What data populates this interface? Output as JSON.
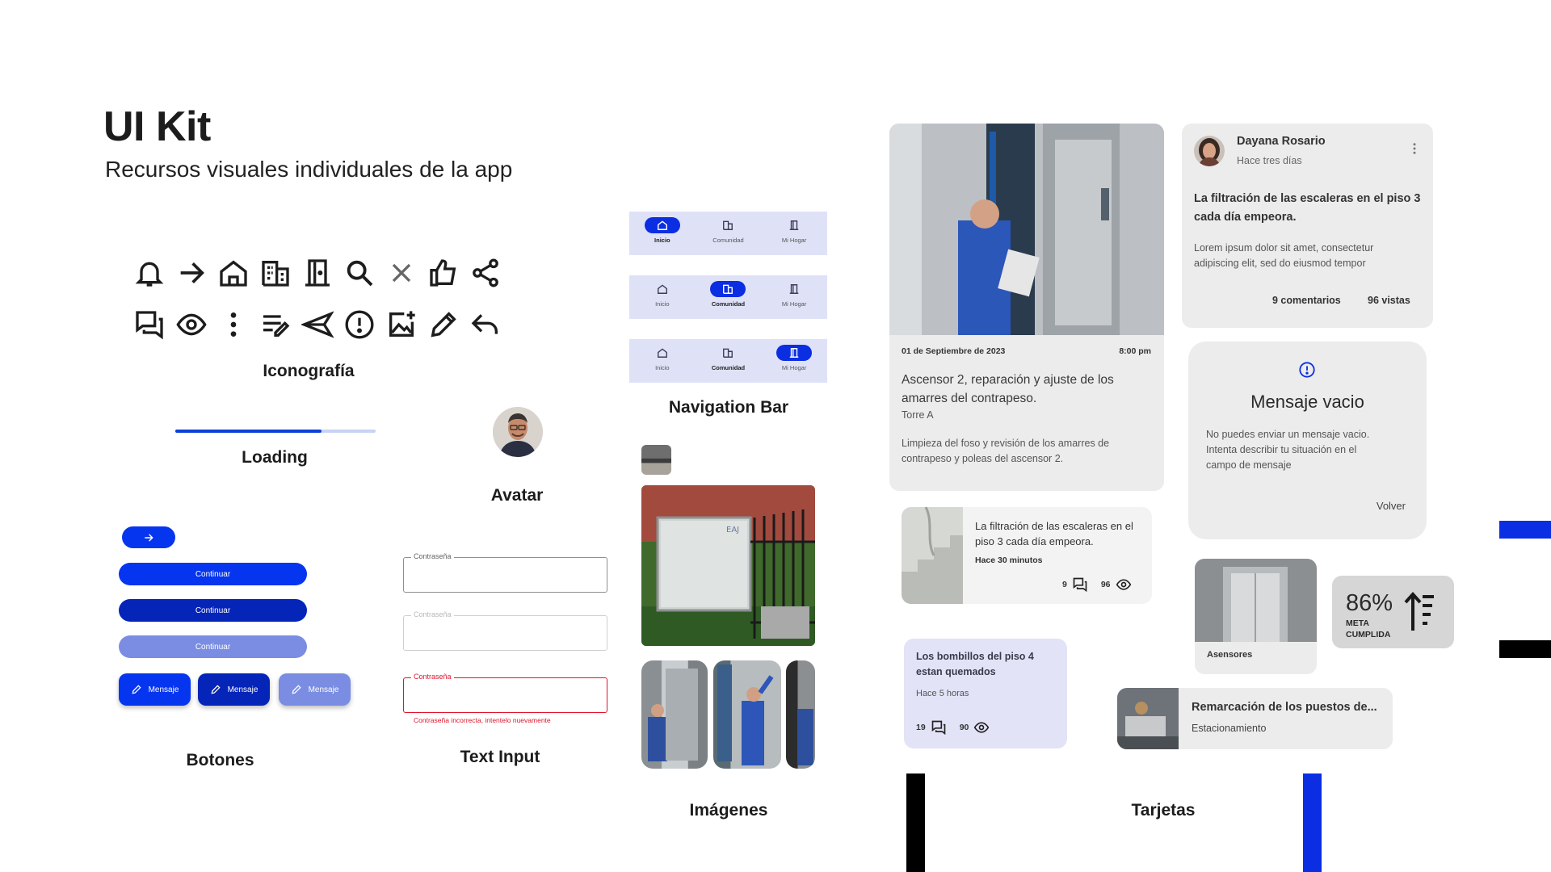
{
  "header": {
    "title": "UI Kit",
    "subtitle": "Recursos visuales individuales de la app"
  },
  "sections": {
    "iconography": "Iconografía",
    "loading": "Loading",
    "avatar": "Avatar",
    "buttons": "Botones",
    "text_input": "Text Input",
    "navigation_bar": "Navigation Bar",
    "images": "Imágenes",
    "cards": "Tarjetas"
  },
  "icons": {
    "row1": [
      "bell-icon",
      "arrow-right-icon",
      "home-icon",
      "apartment-icon",
      "door-icon",
      "search-icon",
      "close-icon",
      "thumb-up-icon",
      "share-icon"
    ],
    "row2": [
      "forum-icon",
      "eye-icon",
      "more-vertical-icon",
      "edit-note-icon",
      "send-icon",
      "alert-circle-icon",
      "add-photo-icon",
      "pencil-icon",
      "reply-icon"
    ]
  },
  "loading": {
    "progress": 0.73,
    "color": "#0b3fd8",
    "track": "#c9d3f3"
  },
  "navbar": {
    "items": [
      "Inicio",
      "Comunidad",
      "Mi Hogar"
    ],
    "active_indices": [
      0,
      1,
      2
    ]
  },
  "buttons": {
    "continue_label": "Continuar",
    "message_label": "Mensaje",
    "colors": {
      "primary": "#0635f0",
      "dark": "#0524b8",
      "disabled": "#7a8de2"
    }
  },
  "inputs": {
    "label": "Contraseña",
    "error_message": "Contraseña incorrecta, intentelo nuevamente",
    "error_color": "#e0142b"
  },
  "cards": {
    "feature": {
      "date": "01 de Septiembre de 2023",
      "time": "8:00 pm",
      "title": "Ascensor 2, reparación y ajuste de los amarres del contrapeso.",
      "location": "Torre A",
      "description": "Limpieza del foso y revisión de los amarres de contrapeso y poleas del ascensor 2."
    },
    "post": {
      "author": "Dayana Rosario",
      "time": "Hace tres días",
      "title": "La filtración de las escaleras en el piso 3 cada día empeora.",
      "body": "Lorem ipsum dolor sit amet, consectetur adipiscing elit, sed do eiusmod tempor",
      "comments": "9 comentarios",
      "views": "96 vistas"
    },
    "dialog": {
      "title": "Mensaje vacio",
      "body": "No puedes enviar un mensaje vacio. Intenta describir tu situación en el campo de mensaje",
      "action": "Volver"
    },
    "compact": {
      "title": "La filtración de las escaleras en el piso 3 cada día empeora.",
      "time": "Hace 30 minutos",
      "comments": "9",
      "views": "96"
    },
    "bulbs": {
      "title": "Los bombillos del piso 4 estan quemados",
      "time": "Hace 5 horas",
      "comments": "19",
      "views": "90"
    },
    "elevators": {
      "label": "Asensores"
    },
    "goal": {
      "percent": "86%",
      "label_line1": "META",
      "label_line2": "CUMPLIDA"
    },
    "parking": {
      "title": "Remarcación de los puestos de...",
      "subtitle": "Estacionamiento"
    }
  },
  "colors": {
    "accent": "#0b2ee3",
    "card_bg": "#ececec",
    "lavender": "#e2e3f7"
  }
}
